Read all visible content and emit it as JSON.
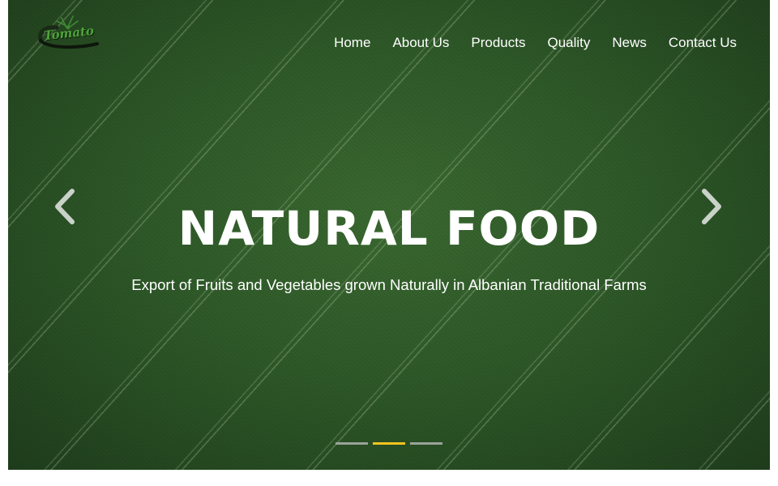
{
  "brand": {
    "logo_text": "Tomato"
  },
  "nav": {
    "items": [
      {
        "label": "Home"
      },
      {
        "label": "About Us"
      },
      {
        "label": "Products"
      },
      {
        "label": "Quality"
      },
      {
        "label": "News"
      },
      {
        "label": "Contact Us"
      }
    ]
  },
  "hero": {
    "title": "NATURAL FOOD",
    "subtitle": "Export of Fruits and Vegetables grown Naturally in Albanian Traditional Farms",
    "prev_icon": "chevron-left-icon",
    "next_icon": "chevron-right-icon"
  },
  "carousel": {
    "slide_count": 3,
    "active_index": 1
  },
  "colors": {
    "accent": "#f2c320",
    "indicator_inactive": "#9aa39a",
    "text": "#ffffff"
  }
}
